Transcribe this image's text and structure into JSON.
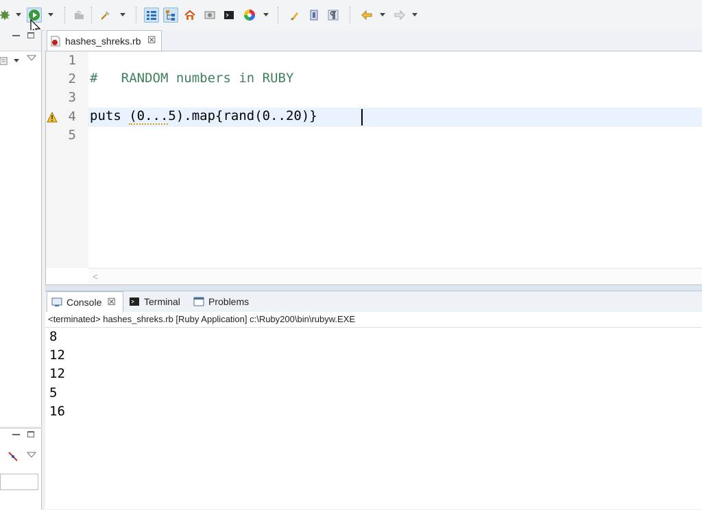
{
  "toolbar": {
    "icons": [
      "debug-icon",
      "run-icon",
      "open-type-icon",
      "build-icon",
      "outline-icon",
      "hierarchy-icon",
      "home-icon",
      "preview-icon",
      "terminal-icon",
      "color-wheel-icon",
      "brush-icon",
      "block-icon",
      "pilcrow-icon",
      "back-arrow-icon",
      "forward-arrow-icon"
    ]
  },
  "editor": {
    "tab_title": "hashes_shreks.rb",
    "tab_close": "☒",
    "line_numbers": [
      "1",
      "2",
      "3",
      "4",
      "5"
    ],
    "comment_text": "#   RANDOM numbers in RUBY",
    "code_pre": "puts ",
    "code_squiggle": "(0...",
    "code_post": "5).map{rand(0..20)}"
  },
  "console": {
    "tabs": {
      "console": "Console",
      "terminal": "Terminal",
      "problems": "Problems"
    },
    "close_glyph": "☒",
    "status": "<terminated> hashes_shreks.rb [Ruby Application] c:\\Ruby200\\bin\\rubyw.EXE",
    "output": [
      "8",
      "12",
      "12",
      "5",
      "16"
    ]
  },
  "colors": {
    "comment": "#3f7f5f",
    "current_line": "#e8f2fe",
    "accent": "#cfe3f7"
  }
}
